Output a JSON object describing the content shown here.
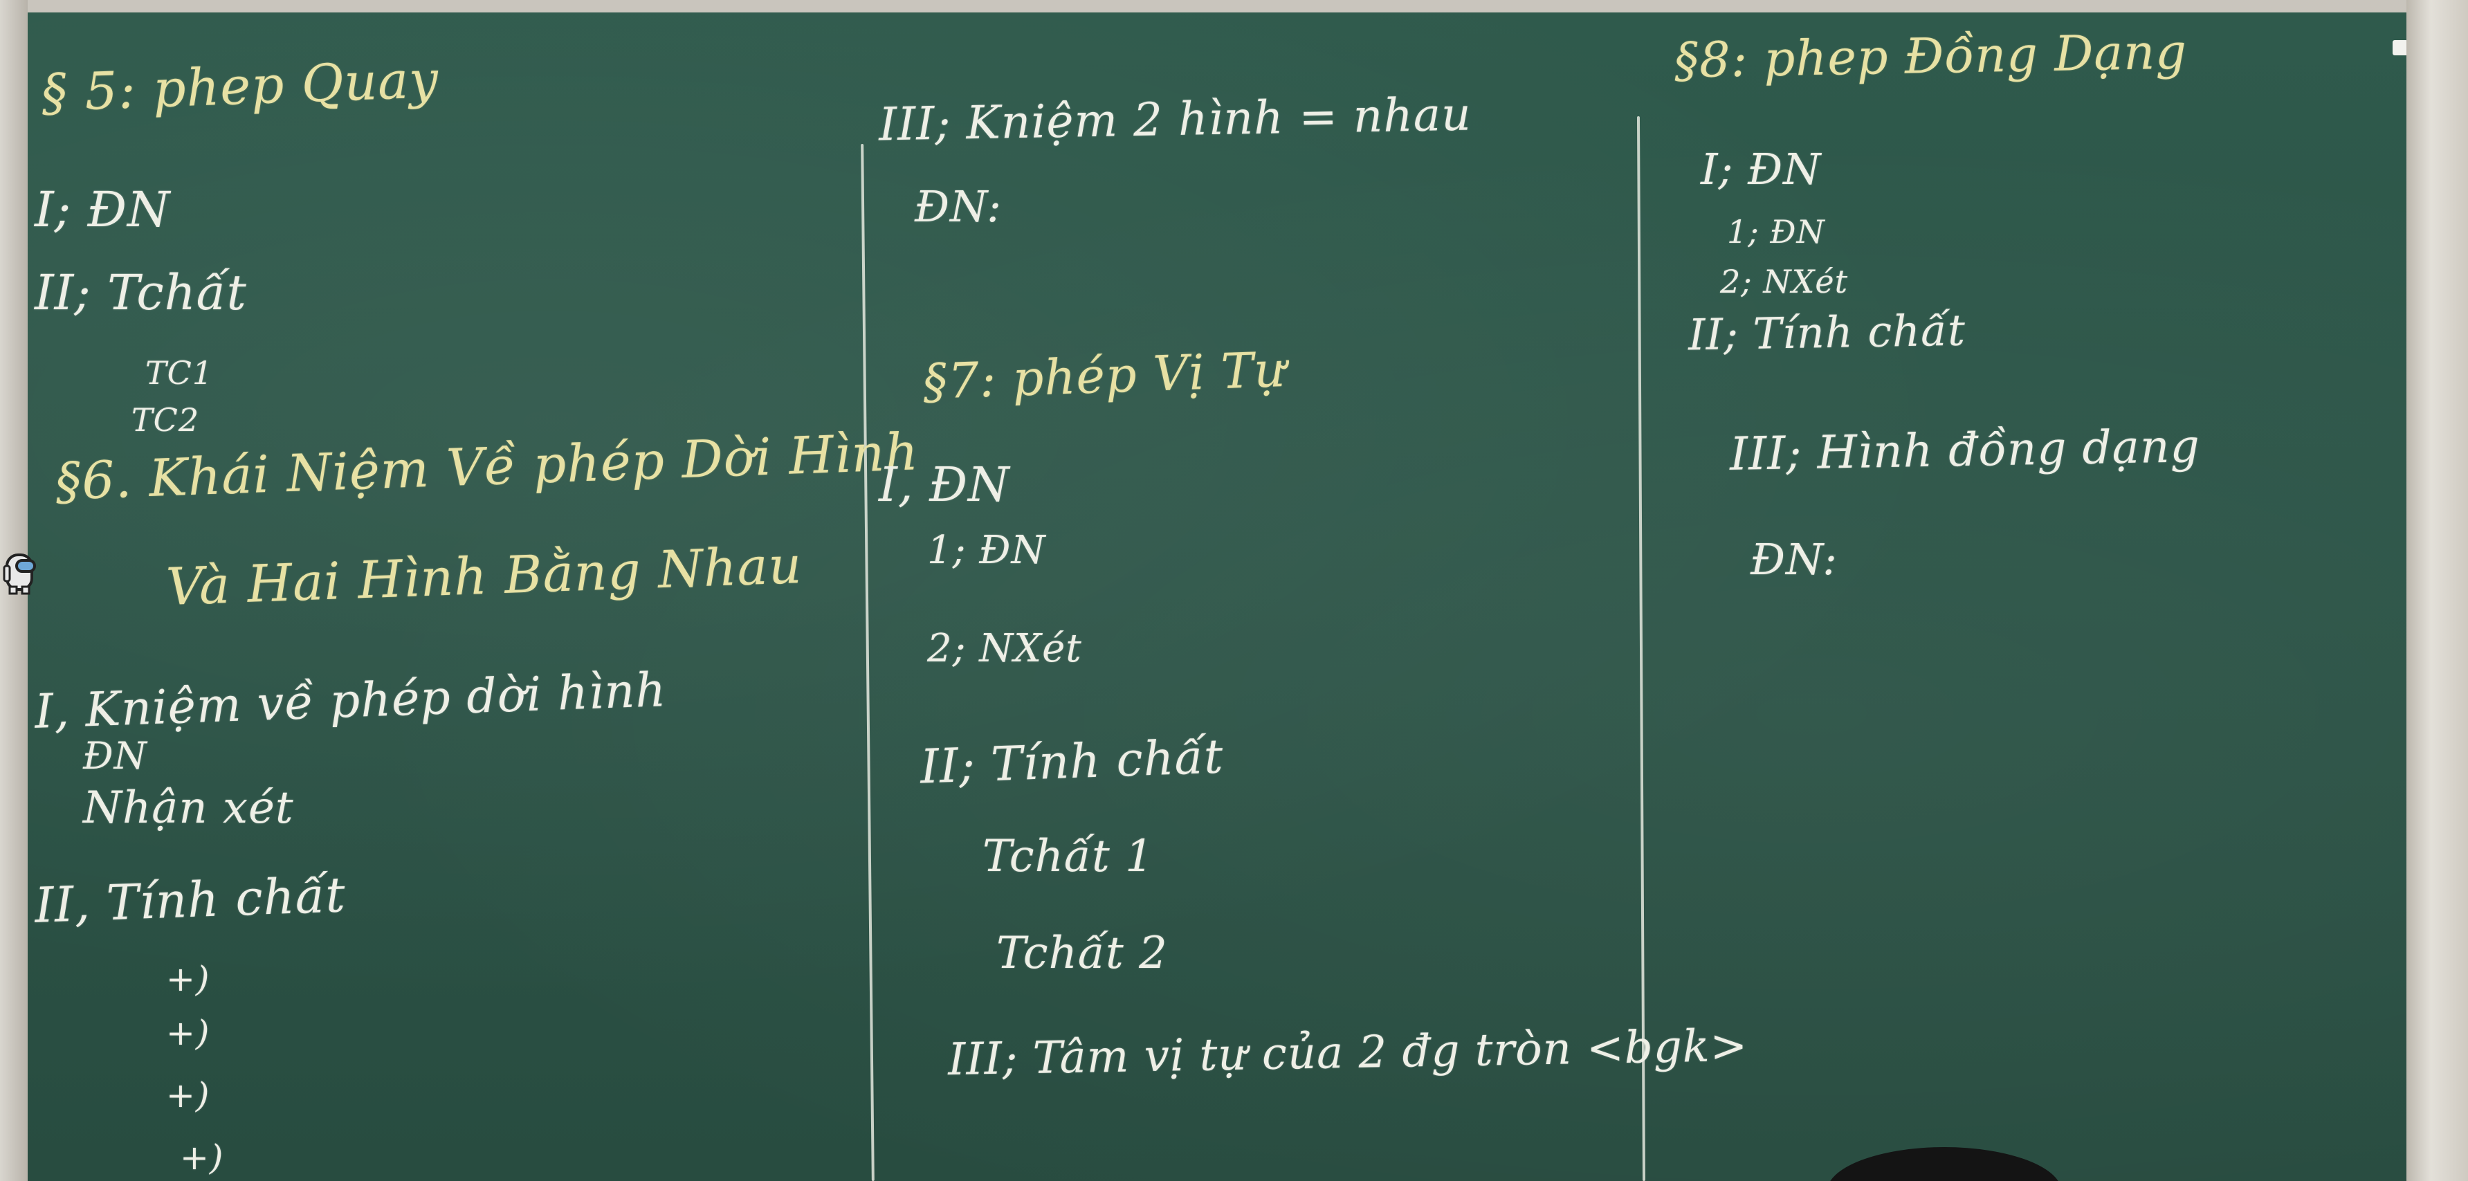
{
  "board": {
    "left_column": {
      "s5_title": "§ 5: phep Quay",
      "s5_def": "I; ĐN",
      "s5_props": "II; Tchất",
      "tc1": "TC1",
      "tc2": "TC2",
      "s6_title": "§6. Khái Niệm Về phép Dời Hình",
      "s6_subtitle": "Và Hai Hình Bằng Nhau",
      "s6_concept": "I, Kniệm về phép dời hình",
      "s6_def": "ĐN",
      "s6_remark": "Nhận xét",
      "s6_props": "II, Tính chất",
      "bullets": [
        "+)",
        "+)",
        "+)",
        "+)"
      ]
    },
    "middle_column": {
      "s6_iii": "III; Kniệm 2 hình = nhau",
      "s6_iii_def": "ĐN:",
      "s7_title": "§7: phép Vị Tự",
      "s7_def": "I, ĐN",
      "s7_def_1": "1; ĐN",
      "s7_def_2": "2; NXét",
      "s7_props": "II; Tính chất",
      "tchat1": "Tchất 1",
      "tchat2": "Tchất 2",
      "s7_iii": "III; Tâm vị tự của 2 đg tròn <bgk>"
    },
    "right_column": {
      "s8_title": "§8: phep Đồng Dạng",
      "s8_def": "I; ĐN",
      "s8_def_1": "1; ĐN",
      "s8_def_2": "2; NXét",
      "s8_props": "II; Tính chất",
      "s8_iii": "III; Hình đồng dạng",
      "s8_iii_def": "ĐN:"
    }
  },
  "icons": {
    "amogus": "crewmate-icon"
  },
  "colors": {
    "chalkboard": "#2c5447",
    "chalk_white": "#eeefe6",
    "chalk_yellow": "#e7e1a4",
    "frame": "#c9c5bd"
  }
}
